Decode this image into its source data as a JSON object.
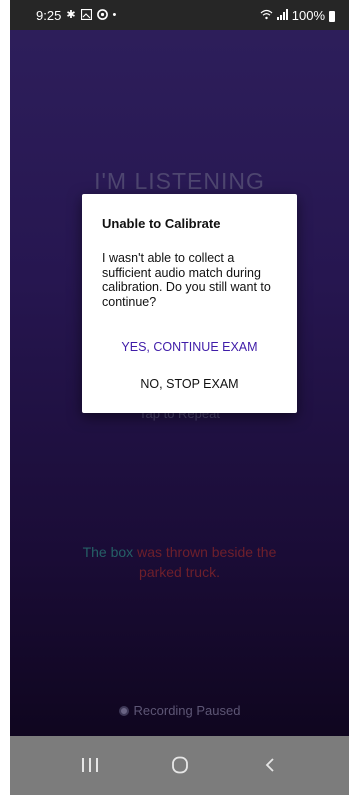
{
  "status_bar": {
    "time": "9:25",
    "left_icons": [
      "settings-icon",
      "gallery-icon",
      "app-icon",
      "dot-icon"
    ],
    "battery": "100%"
  },
  "screen": {
    "title": "I'M LISTENING",
    "hint": "Tap to Repeat",
    "sentence": {
      "part1": "The box",
      "part2": "was thrown beside the parked truck."
    },
    "recording_status": "Recording Paused"
  },
  "dialog": {
    "title": "Unable to Calibrate",
    "message": "I wasn't able to collect a sufficient audio match during calibration. Do you still want to continue?",
    "confirm_label": "YES, CONTINUE EXAM",
    "cancel_label": "NO, STOP EXAM",
    "accent_color": "#3f1ca8"
  },
  "nav_bar": {
    "buttons": [
      "recent-apps-icon",
      "home-icon",
      "back-icon"
    ]
  }
}
